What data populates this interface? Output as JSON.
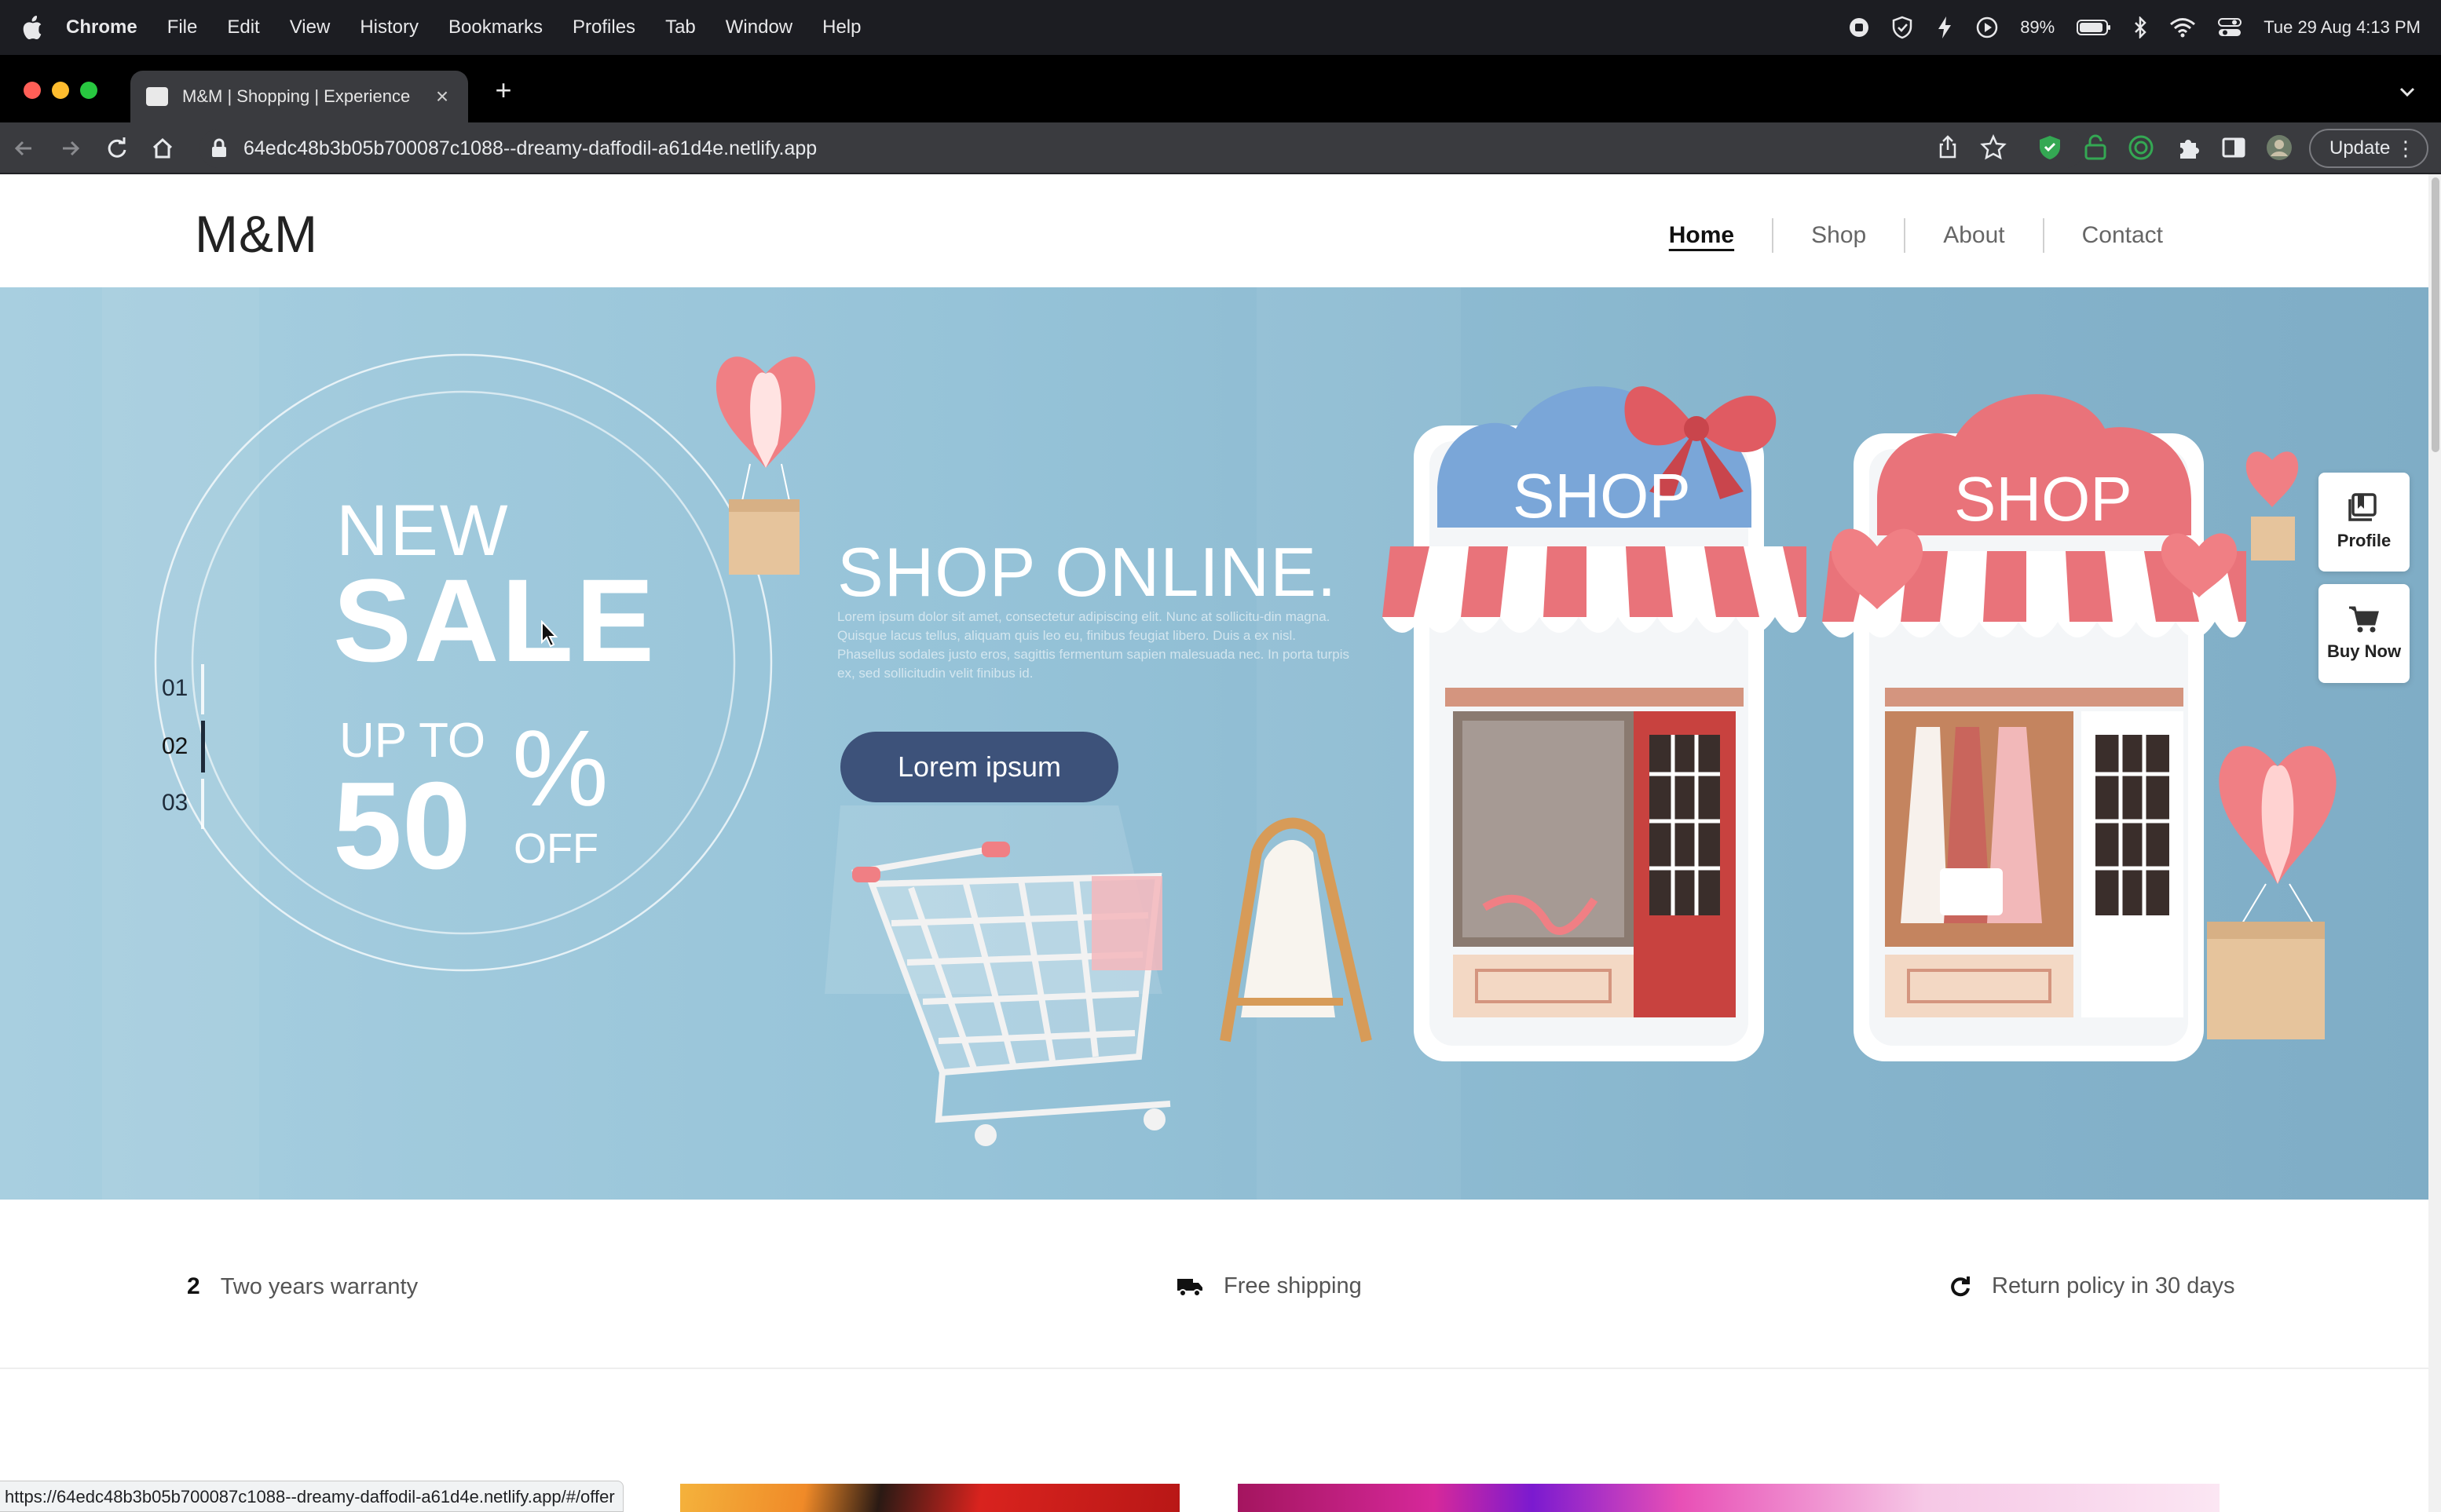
{
  "menubar": {
    "app": "Chrome",
    "items": [
      "File",
      "Edit",
      "View",
      "History",
      "Bookmarks",
      "Profiles",
      "Tab",
      "Window",
      "Help"
    ],
    "battery": "89%",
    "datetime": "Tue 29 Aug  4:13 PM"
  },
  "browser": {
    "tab_title": "M&M | Shopping | Experience",
    "url": "64edc48b3b05b700087c1088--dreamy-daffodil-a61d4e.netlify.app",
    "update_label": "Update",
    "status_url": "https://64edc48b3b05b700087c1088--dreamy-daffodil-a61d4e.netlify.app/#/offer"
  },
  "site": {
    "logo": "M&M",
    "nav": [
      {
        "label": "Home",
        "active": true
      },
      {
        "label": "Shop",
        "active": false
      },
      {
        "label": "About",
        "active": false
      },
      {
        "label": "Contact",
        "active": false
      }
    ]
  },
  "hero": {
    "new": "NEW",
    "sale": "SALE",
    "up_to": "UP TO",
    "percent_value": "50",
    "percent_sign": "%",
    "off": "OFF",
    "headline": "SHOP ONLINE.",
    "body": "Lorem ipsum dolor sit amet, consectetur adipiscing elit. Nunc at sollicitu-din magna. Quisque lacus tellus, aliquam quis leo eu, finibus feugiat libero. Duis a ex nisl. Phasellus sodales justo eros, sagittis fermentum sapien malesuada nec. In porta turpis ex, sed sollicitudin velit finibus id.",
    "cta": "Lorem ipsum",
    "shop_sign_1": "SHOP",
    "shop_sign_2": "SHOP",
    "slides": [
      "01",
      "02",
      "03"
    ],
    "active_slide": "02"
  },
  "float_buttons": {
    "profile": "Profile",
    "buy_now": "Buy Now"
  },
  "features": {
    "warranty_icon_text": "2",
    "warranty": "Two years warranty",
    "shipping": "Free shipping",
    "returns": "Return policy in 30 days"
  },
  "colors": {
    "hero_bg": "#96c3d8",
    "cta_bg": "#3d527a",
    "awning_red": "#e9737a"
  }
}
